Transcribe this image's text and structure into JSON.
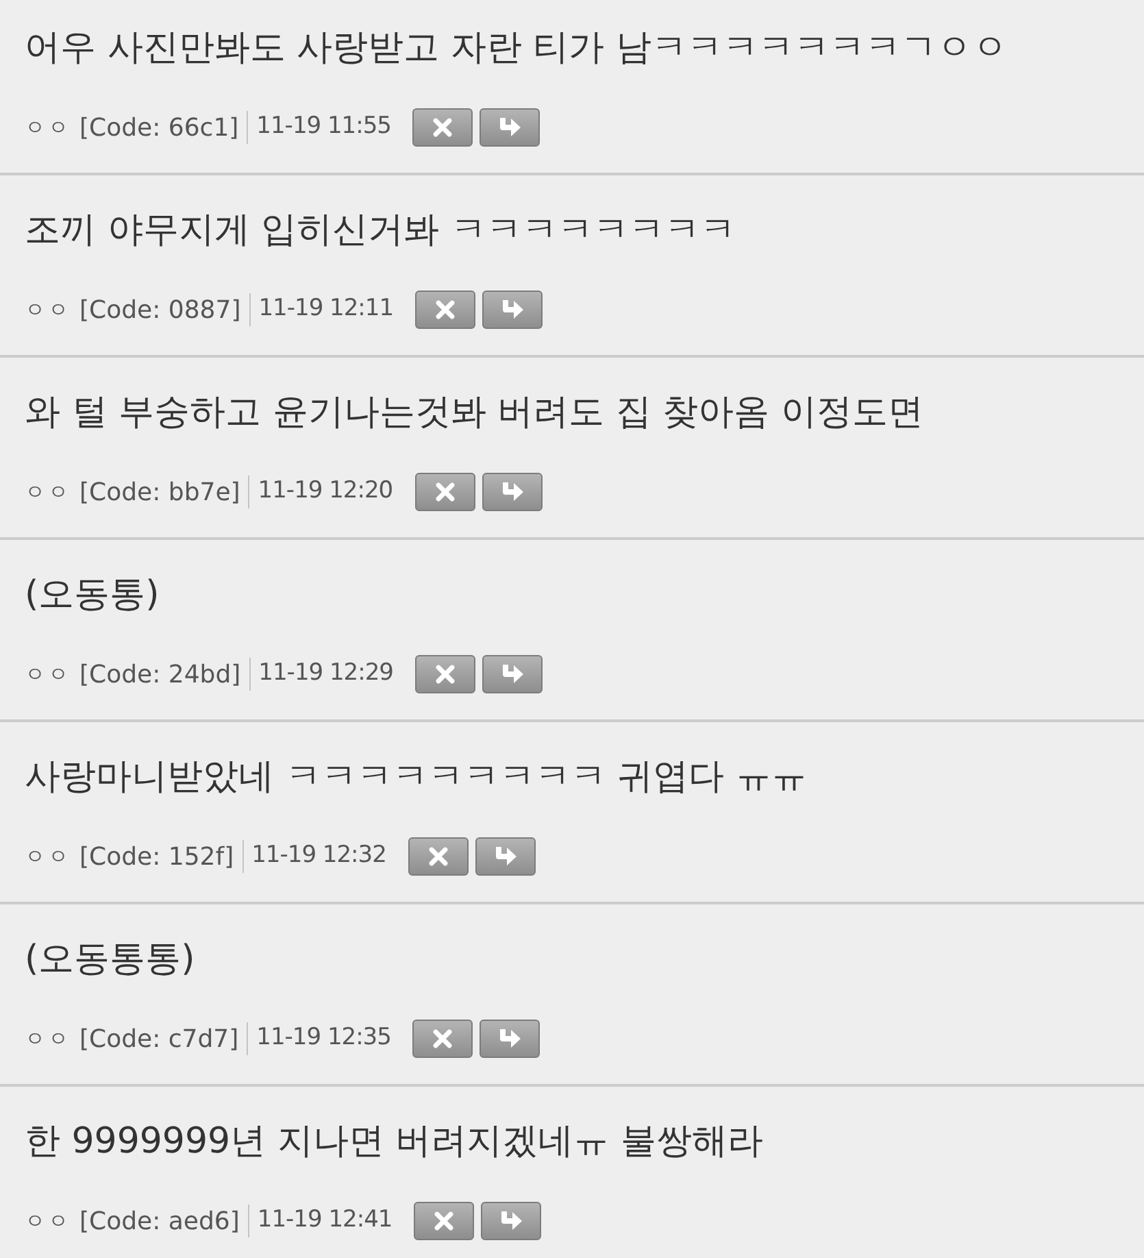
{
  "comments": [
    {
      "text": "어우 사진만봐도 사랑받고 자란 티가 남ㅋㅋㅋㅋㅋㅋㅋㄱㅇㅇ",
      "author": "ㅇㅇ",
      "code": "[Code: 66c1]",
      "time": "11-19 11:55"
    },
    {
      "text": "조끼 야무지게 입히신거봐 ㅋㅋㅋㅋㅋㅋㅋㅋ",
      "author": "ㅇㅇ",
      "code": "[Code: 0887]",
      "time": "11-19 12:11"
    },
    {
      "text": "와 털 부숭하고 윤기나는것봐 버려도 집 찾아옴 이정도면",
      "author": "ㅇㅇ",
      "code": "[Code: bb7e]",
      "time": "11-19 12:20"
    },
    {
      "text": "(오동통)",
      "author": "ㅇㅇ",
      "code": "[Code: 24bd]",
      "time": "11-19 12:29"
    },
    {
      "text": "사랑마니받았네 ㅋㅋㅋㅋㅋㅋㅋㅋㅋ 귀엽다 ㅠㅠ",
      "author": "ㅇㅇ",
      "code": "[Code: 152f]",
      "time": "11-19 12:32"
    },
    {
      "text": "(오동통통)",
      "author": "ㅇㅇ",
      "code": "[Code: c7d7]",
      "time": "11-19 12:35"
    },
    {
      "text": "한 9999999년 지나면 버려지겠네ㅠ 불쌍해라",
      "author": "ㅇㅇ",
      "code": "[Code: aed6]",
      "time": "11-19 12:41"
    }
  ]
}
